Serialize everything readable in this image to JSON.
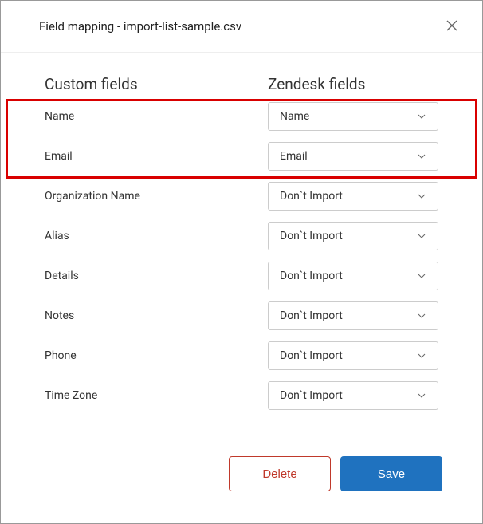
{
  "dialog": {
    "title": "Field mapping - import-list-sample.csv"
  },
  "columns": {
    "left": "Custom fields",
    "right": "Zendesk fields"
  },
  "rows": [
    {
      "label": "Name",
      "value": "Name"
    },
    {
      "label": "Email",
      "value": "Email"
    },
    {
      "label": "Organization Name",
      "value": "Don`t Import"
    },
    {
      "label": "Alias",
      "value": "Don`t Import"
    },
    {
      "label": "Details",
      "value": "Don`t Import"
    },
    {
      "label": "Notes",
      "value": "Don`t Import"
    },
    {
      "label": "Phone",
      "value": "Don`t Import"
    },
    {
      "label": "Time Zone",
      "value": "Don`t Import"
    }
  ],
  "buttons": {
    "delete": "Delete",
    "save": "Save"
  }
}
